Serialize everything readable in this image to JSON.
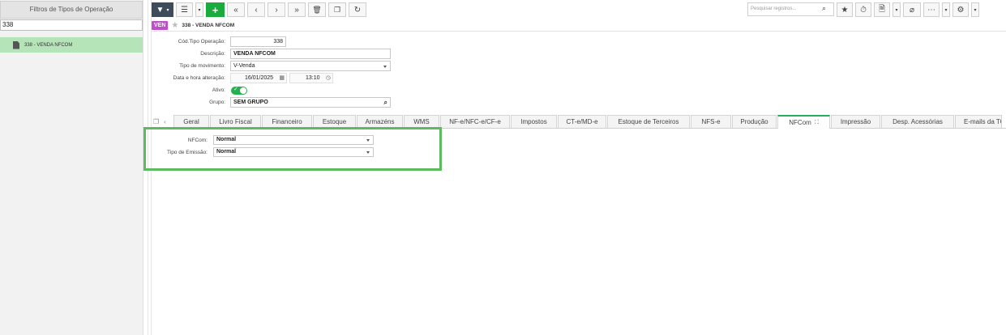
{
  "left_panel": {
    "header": "Filtros de Tipos de Operação",
    "search_value": "338",
    "items": [
      {
        "label": "338 - VENDA NFCOM"
      }
    ]
  },
  "toolbar": {
    "search_placeholder": "Pesquisar registros...",
    "icons": [
      "filter-icon",
      "list-view-icon",
      "add-icon",
      "first-icon",
      "prev-icon",
      "next-icon",
      "last-icon",
      "delete-icon",
      "copy-icon",
      "refresh-icon",
      "star-icon",
      "timer-icon",
      "document-icon",
      "attach-icon",
      "more-icon",
      "settings-icon"
    ]
  },
  "record": {
    "badge": "VEN",
    "title": "338 - VENDA NFCOM"
  },
  "form": {
    "cod_label": "Cód.Tipo Operação:",
    "cod_value": "338",
    "desc_label": "Descrição:",
    "desc_value": "VENDA NFCOM",
    "tipo_label": "Tipo de movimento:",
    "tipo_value": "V-Venda",
    "data_label": "Data e hora alteração:",
    "data_value": "16/01/2025",
    "hora_value": "13:10",
    "ativo_label": "Ativo:",
    "grupo_label": "Grupo:",
    "grupo_value": "SEM GRUPO"
  },
  "tabs": [
    {
      "label": "Geral"
    },
    {
      "label": "Livro Fiscal"
    },
    {
      "label": "Financeiro"
    },
    {
      "label": "Estoque"
    },
    {
      "label": "Armazéns"
    },
    {
      "label": "WMS"
    },
    {
      "label": "NF-e/NFC-e/CF-e"
    },
    {
      "label": "Impostos"
    },
    {
      "label": "CT-e/MD-e"
    },
    {
      "label": "Estoque de Terceiros"
    },
    {
      "label": "NFS-e"
    },
    {
      "label": "Produção"
    },
    {
      "label": "NFCom"
    },
    {
      "label": "Impressão"
    },
    {
      "label": "Desp. Acessórias"
    },
    {
      "label": "E-mails da TO"
    }
  ],
  "nfcom": {
    "nfcom_label": "NFCom:",
    "nfcom_value": "Normal",
    "emissao_label": "Tipo de Emissão:",
    "emissao_value": "Normal"
  },
  "colors": {
    "accent_green": "#27ae60",
    "badge": "#c04dcb",
    "highlight": "#5bbb5e"
  }
}
